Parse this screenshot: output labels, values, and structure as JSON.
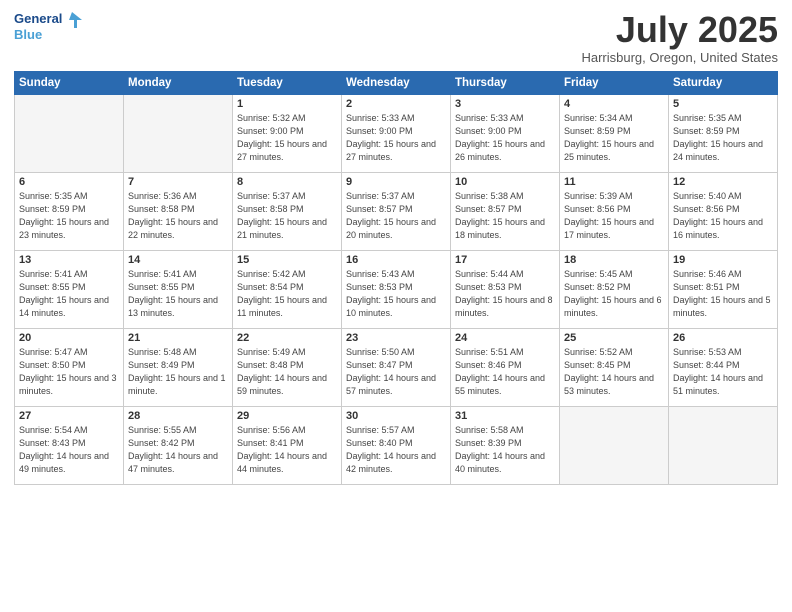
{
  "header": {
    "logo_line1": "General",
    "logo_line2": "Blue",
    "month": "July 2025",
    "location": "Harrisburg, Oregon, United States"
  },
  "weekdays": [
    "Sunday",
    "Monday",
    "Tuesday",
    "Wednesday",
    "Thursday",
    "Friday",
    "Saturday"
  ],
  "weeks": [
    [
      {
        "num": "",
        "info": ""
      },
      {
        "num": "",
        "info": ""
      },
      {
        "num": "1",
        "info": "Sunrise: 5:32 AM\nSunset: 9:00 PM\nDaylight: 15 hours and 27 minutes."
      },
      {
        "num": "2",
        "info": "Sunrise: 5:33 AM\nSunset: 9:00 PM\nDaylight: 15 hours and 27 minutes."
      },
      {
        "num": "3",
        "info": "Sunrise: 5:33 AM\nSunset: 9:00 PM\nDaylight: 15 hours and 26 minutes."
      },
      {
        "num": "4",
        "info": "Sunrise: 5:34 AM\nSunset: 8:59 PM\nDaylight: 15 hours and 25 minutes."
      },
      {
        "num": "5",
        "info": "Sunrise: 5:35 AM\nSunset: 8:59 PM\nDaylight: 15 hours and 24 minutes."
      }
    ],
    [
      {
        "num": "6",
        "info": "Sunrise: 5:35 AM\nSunset: 8:59 PM\nDaylight: 15 hours and 23 minutes."
      },
      {
        "num": "7",
        "info": "Sunrise: 5:36 AM\nSunset: 8:58 PM\nDaylight: 15 hours and 22 minutes."
      },
      {
        "num": "8",
        "info": "Sunrise: 5:37 AM\nSunset: 8:58 PM\nDaylight: 15 hours and 21 minutes."
      },
      {
        "num": "9",
        "info": "Sunrise: 5:37 AM\nSunset: 8:57 PM\nDaylight: 15 hours and 20 minutes."
      },
      {
        "num": "10",
        "info": "Sunrise: 5:38 AM\nSunset: 8:57 PM\nDaylight: 15 hours and 18 minutes."
      },
      {
        "num": "11",
        "info": "Sunrise: 5:39 AM\nSunset: 8:56 PM\nDaylight: 15 hours and 17 minutes."
      },
      {
        "num": "12",
        "info": "Sunrise: 5:40 AM\nSunset: 8:56 PM\nDaylight: 15 hours and 16 minutes."
      }
    ],
    [
      {
        "num": "13",
        "info": "Sunrise: 5:41 AM\nSunset: 8:55 PM\nDaylight: 15 hours and 14 minutes."
      },
      {
        "num": "14",
        "info": "Sunrise: 5:41 AM\nSunset: 8:55 PM\nDaylight: 15 hours and 13 minutes."
      },
      {
        "num": "15",
        "info": "Sunrise: 5:42 AM\nSunset: 8:54 PM\nDaylight: 15 hours and 11 minutes."
      },
      {
        "num": "16",
        "info": "Sunrise: 5:43 AM\nSunset: 8:53 PM\nDaylight: 15 hours and 10 minutes."
      },
      {
        "num": "17",
        "info": "Sunrise: 5:44 AM\nSunset: 8:53 PM\nDaylight: 15 hours and 8 minutes."
      },
      {
        "num": "18",
        "info": "Sunrise: 5:45 AM\nSunset: 8:52 PM\nDaylight: 15 hours and 6 minutes."
      },
      {
        "num": "19",
        "info": "Sunrise: 5:46 AM\nSunset: 8:51 PM\nDaylight: 15 hours and 5 minutes."
      }
    ],
    [
      {
        "num": "20",
        "info": "Sunrise: 5:47 AM\nSunset: 8:50 PM\nDaylight: 15 hours and 3 minutes."
      },
      {
        "num": "21",
        "info": "Sunrise: 5:48 AM\nSunset: 8:49 PM\nDaylight: 15 hours and 1 minute."
      },
      {
        "num": "22",
        "info": "Sunrise: 5:49 AM\nSunset: 8:48 PM\nDaylight: 14 hours and 59 minutes."
      },
      {
        "num": "23",
        "info": "Sunrise: 5:50 AM\nSunset: 8:47 PM\nDaylight: 14 hours and 57 minutes."
      },
      {
        "num": "24",
        "info": "Sunrise: 5:51 AM\nSunset: 8:46 PM\nDaylight: 14 hours and 55 minutes."
      },
      {
        "num": "25",
        "info": "Sunrise: 5:52 AM\nSunset: 8:45 PM\nDaylight: 14 hours and 53 minutes."
      },
      {
        "num": "26",
        "info": "Sunrise: 5:53 AM\nSunset: 8:44 PM\nDaylight: 14 hours and 51 minutes."
      }
    ],
    [
      {
        "num": "27",
        "info": "Sunrise: 5:54 AM\nSunset: 8:43 PM\nDaylight: 14 hours and 49 minutes."
      },
      {
        "num": "28",
        "info": "Sunrise: 5:55 AM\nSunset: 8:42 PM\nDaylight: 14 hours and 47 minutes."
      },
      {
        "num": "29",
        "info": "Sunrise: 5:56 AM\nSunset: 8:41 PM\nDaylight: 14 hours and 44 minutes."
      },
      {
        "num": "30",
        "info": "Sunrise: 5:57 AM\nSunset: 8:40 PM\nDaylight: 14 hours and 42 minutes."
      },
      {
        "num": "31",
        "info": "Sunrise: 5:58 AM\nSunset: 8:39 PM\nDaylight: 14 hours and 40 minutes."
      },
      {
        "num": "",
        "info": ""
      },
      {
        "num": "",
        "info": ""
      }
    ]
  ]
}
